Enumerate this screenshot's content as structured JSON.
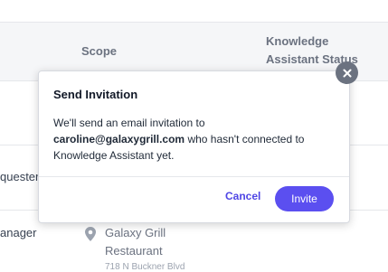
{
  "table": {
    "headers": {
      "scope": "Scope",
      "knowledge_assistant_status": "Knowledge Assistant Status"
    },
    "rows": [
      {
        "role": "quester"
      },
      {
        "role": "anager",
        "scope_name": "Galaxy Grill Restaurant",
        "scope_address": "718 N Buckner Blvd"
      }
    ]
  },
  "modal": {
    "title": "Send Invitation",
    "body_prefix": "We'll send an email invitation to",
    "email": "caroline@galaxygrill.com",
    "body_suffix": "who hasn't connected to Knowledge Assistant yet.",
    "cancel_label": "Cancel",
    "invite_label": "Invite",
    "close_label": "×"
  }
}
